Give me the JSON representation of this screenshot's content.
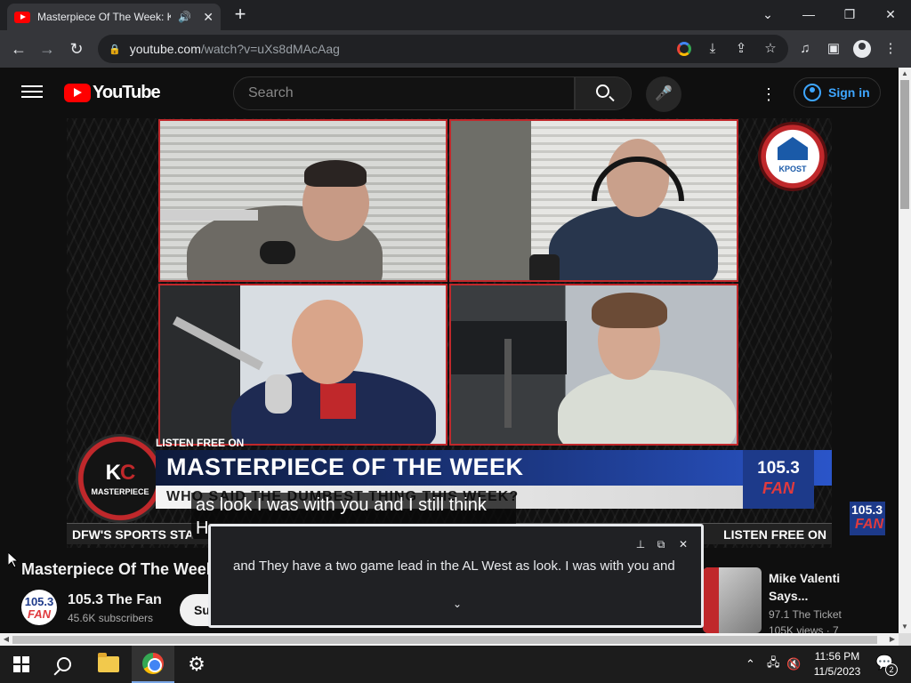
{
  "browser": {
    "tab_title": "Masterpiece Of The Week: K",
    "tab_audio_icon": "speaker-icon",
    "tab_close": "✕",
    "new_tab": "+",
    "window_minimize": "—",
    "window_restore": "❐",
    "window_close": "✕",
    "url_host": "youtube.com",
    "url_path": "/watch?v=uXs8dMAcAag"
  },
  "youtube": {
    "logo_text": "YouTube",
    "search_placeholder": "Search",
    "sign_in": "Sign in",
    "more": "⋮"
  },
  "video": {
    "kpost_logo": "KPOST",
    "badge_kc": "K",
    "badge_kc_c": "C",
    "badge_sub": "MASTERPIECE",
    "listen_tag": "LISTEN FREE ON",
    "show_title": "MASTERPIECE OF THE WEEK",
    "show_subtitle": "WHO SAID THE DUMBEST THING THIS WEEK?",
    "fan_number": "105.3",
    "fan_word": "FAN",
    "ticker_left": "DFW'S SPORTS STA",
    "ticker_right": "LISTEN FREE ON",
    "caption_line1": "as look I was with you and I still think",
    "caption_line2": "H"
  },
  "below": {
    "video_title": "Masterpiece Of The Week",
    "channel_name": "105.3 The Fan",
    "subscribers": "45.6K subscribers",
    "subscribe": "Subscribe",
    "rec_title": "Mike Valenti Says...",
    "rec_channel": "97.1 The Ticket",
    "rec_views": "105K views · 7"
  },
  "live_caption": {
    "text": "and They have a two game lead in the AL West as look. I was with you and",
    "pin_icon": "📌",
    "popout_icon": "⧉",
    "close_icon": "✕",
    "expand_icon": "⌄"
  },
  "taskbar": {
    "clock_time": "11:56 PM",
    "clock_date": "11/5/2023",
    "notif_count": "2"
  }
}
